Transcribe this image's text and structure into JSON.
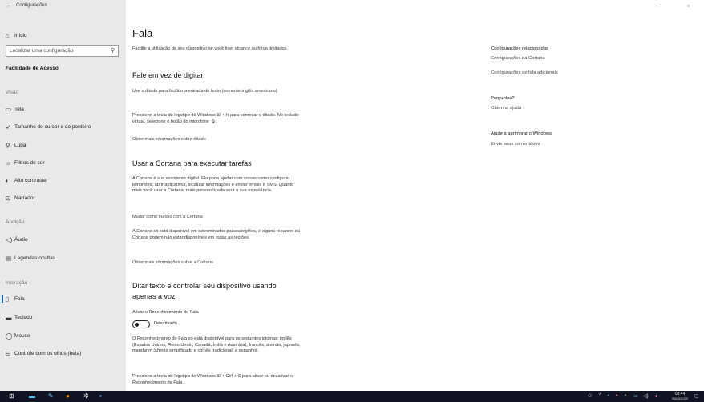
{
  "window": {
    "title": "Configurações"
  },
  "sidebar": {
    "home": "Início",
    "search_placeholder": "Localizar uma configuração",
    "category": "Facilidade de Acesso",
    "sections": {
      "visao": "Visão",
      "audicao": "Audição",
      "interacao": "Interação"
    },
    "items": [
      {
        "label": "Tela",
        "icon": "monitor-icon"
      },
      {
        "label": "Tamanho do cursor e do ponteiro",
        "icon": "cursor-icon"
      },
      {
        "label": "Lupa",
        "icon": "magnifier-icon"
      },
      {
        "label": "Filtros de cor",
        "icon": "color-filter-icon"
      },
      {
        "label": "Alto contraste",
        "icon": "contrast-icon"
      },
      {
        "label": "Narrador",
        "icon": "narrator-icon"
      },
      {
        "label": "Áudio",
        "icon": "speaker-icon"
      },
      {
        "label": "Legendas ocultas",
        "icon": "captions-icon"
      },
      {
        "label": "Fala",
        "icon": "microphone-icon"
      },
      {
        "label": "Teclado",
        "icon": "keyboard-icon"
      },
      {
        "label": "Mouse",
        "icon": "mouse-icon"
      },
      {
        "label": "Controle com os olhos (beta)",
        "icon": "eye-control-icon"
      }
    ]
  },
  "main": {
    "title": "Fala",
    "intro": "Facilite a utilização de seu dispositivo se você tiver alcance ou força limitados.",
    "dictation": {
      "heading": "Fale em vez de digitar",
      "p1": "Use o ditado para facilitar a entrada de texto (somente inglês americano).",
      "p2": "Pressione a tecla do logotipo do Windows ⊞ + H para começar o ditado. No teclado virtual, selecione o botão do microfone 🎙.",
      "link": "Obter mais informações sobre ditado"
    },
    "cortana": {
      "heading": "Usar a Cortana para executar tarefas",
      "p1": "A Cortana é sua assistente digital. Ela pode ajudar com coisas como configurar lembretes, abrir aplicativos, localizar informações e enviar emails e SMS. Quanto mais você usar a Cortana, mais personalizada será a sua experiência.",
      "link1": "Mudar como eu falo com a Cortana",
      "p2": "A Cortana só está disponível em determinados países/regiões, e alguns recursos da Cortana podem não estar disponíveis em todas as regiões.",
      "link2": "Obter mais informações sobre a Cortana"
    },
    "voice": {
      "heading_line1": "Ditar texto e controlar seu dispositivo usando",
      "heading_line2": "apenas a voz",
      "toggle_title": "Ativar o Reconhecimento de Fala",
      "toggle_state": "Desativado",
      "p1": "O Reconhecimento de Fala só está disponível para os seguintes idiomas: inglês (Estados Unidos, Reino Unido, Canadá, Índia e Austrália), francês, alemão, japonês, mandarim (chinês simplificado e chinês tradicional) e espanhol.",
      "p2": "Pressione a tecla do logotipo do Windows ⊞ + Ctrl + S para ativar ou desativar o Reconhecimento de Fala."
    }
  },
  "related": {
    "heading": "Configurações relacionadas",
    "link1": "Configurações da Cortana",
    "link2": "Configurações de fala adicionais",
    "questions_heading": "Perguntas?",
    "questions_link": "Obtenha ajuda",
    "improve_heading": "Ajude a aprimorar o Windows",
    "improve_link": "Envie seus comentários"
  },
  "taskbar": {
    "time": "08:44",
    "date": "05/04/2020",
    "colors": {
      "background": "#101322",
      "accent": "#0067b8"
    }
  }
}
